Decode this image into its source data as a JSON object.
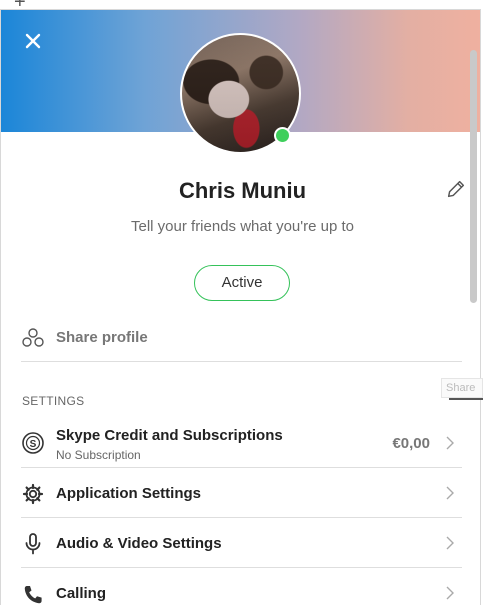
{
  "profile": {
    "name": "Chris Muniu",
    "mood_placeholder": "Tell your friends what you're up to",
    "status": "Active"
  },
  "share": {
    "label": "Share profile"
  },
  "settings": {
    "section_label": "SETTINGS",
    "items": [
      {
        "title": "Skype Credit and Subscriptions",
        "subtitle": "No Subscription",
        "value": "€0,00",
        "icon": "skype-credit-icon"
      },
      {
        "title": "Application Settings",
        "icon": "gear-icon"
      },
      {
        "title": "Audio & Video Settings",
        "icon": "microphone-icon"
      },
      {
        "title": "Calling",
        "icon": "phone-icon"
      }
    ]
  },
  "tooltip": {
    "text": "Share"
  },
  "colors": {
    "gradient_left": "#1b86d8",
    "gradient_right": "#efb0a0",
    "presence_green": "#3fcf5c",
    "status_border": "#35c25a"
  }
}
